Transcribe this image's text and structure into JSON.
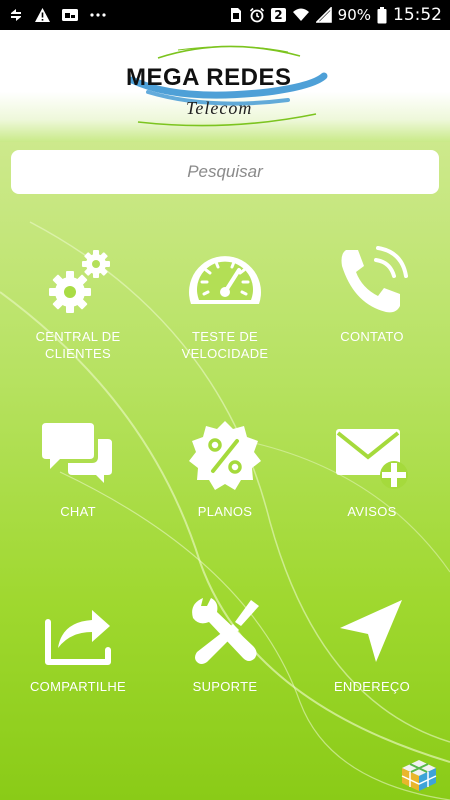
{
  "status_bar": {
    "left_icons": [
      "sync-icon",
      "warning-icon",
      "cast-icon",
      "more-dots-icon"
    ],
    "right_icons": [
      "sim-icon",
      "alarm-icon",
      "dual-sim-icon",
      "wifi-icon",
      "signal-icon",
      "battery-icon"
    ],
    "sim_badge": "2",
    "battery": "90%",
    "time": "15:52"
  },
  "header": {
    "logo_main": "MEGA REDES",
    "logo_sub": "Telecom"
  },
  "search": {
    "placeholder": "Pesquisar"
  },
  "menu": {
    "items": [
      {
        "label": "CENTRAL DE\nCLIENTES",
        "icon": "gears-icon"
      },
      {
        "label": "TESTE DE\nVELOCIDADE",
        "icon": "speedometer-icon"
      },
      {
        "label": "CONTATO",
        "icon": "phone-icon"
      },
      {
        "label": "CHAT",
        "icon": "chat-bubbles-icon"
      },
      {
        "label": "PLANOS",
        "icon": "percent-badge-icon"
      },
      {
        "label": "AVISOS",
        "icon": "mail-plus-icon"
      },
      {
        "label": "COMPARTILHE",
        "icon": "share-icon"
      },
      {
        "label": "SUPORTE",
        "icon": "tools-icon"
      },
      {
        "label": "ENDEREÇO",
        "icon": "navigation-arrow-icon"
      }
    ]
  },
  "colors": {
    "green_top": "#cde98c",
    "green_bottom": "#8acb17",
    "icon_color": "#ffffff"
  }
}
